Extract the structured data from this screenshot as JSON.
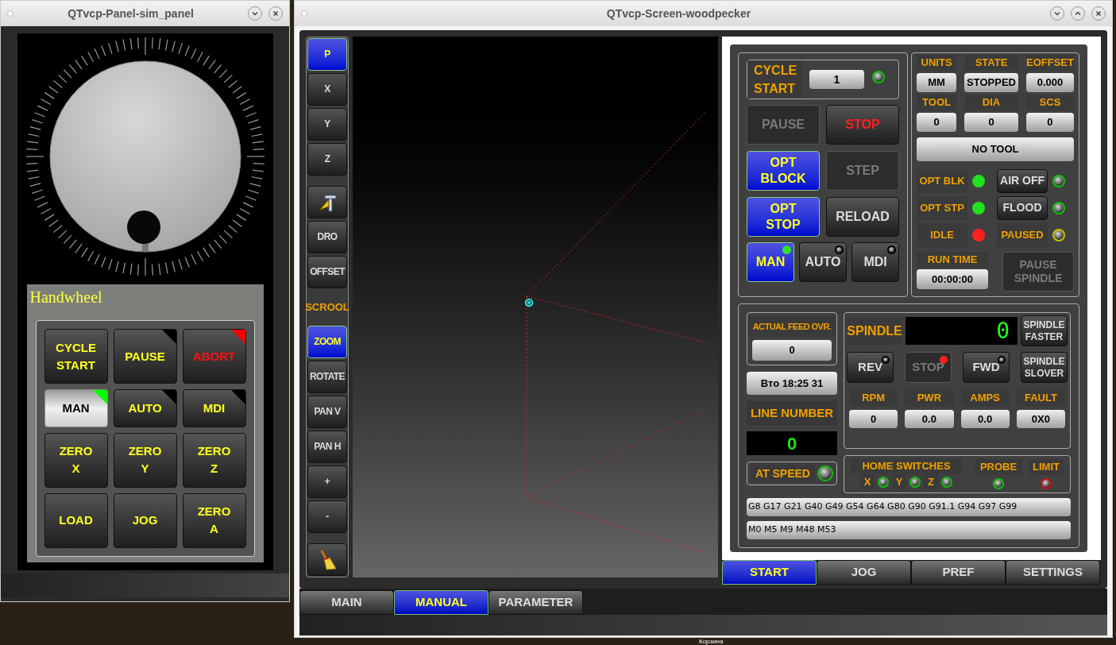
{
  "desktop": {
    "caption": "Корзина"
  },
  "panel_window": {
    "title": "QTvcp-Panel-sim_panel",
    "group_title": "Handwheel",
    "buttons": [
      {
        "label": "CYCLE\nSTART",
        "kind": "normal",
        "selected": false
      },
      {
        "label": "PAUSE",
        "kind": "normal",
        "selected": false,
        "color": "#000000"
      },
      {
        "label": "ABORT",
        "kind": "danger",
        "selected": false,
        "color": "#ff0000"
      },
      {
        "label": "MAN",
        "kind": "normal",
        "selected": true,
        "color": "#00ff00"
      },
      {
        "label": "AUTO",
        "kind": "normal",
        "selected": false,
        "color": "#000000"
      },
      {
        "label": "MDI",
        "kind": "normal",
        "selected": false,
        "color": "#000000"
      },
      {
        "label": "ZERO\nX",
        "kind": "normal",
        "selected": false
      },
      {
        "label": "ZERO\nY",
        "kind": "normal",
        "selected": false
      },
      {
        "label": "ZERO\nZ",
        "kind": "normal",
        "selected": false
      },
      {
        "label": "LOAD",
        "kind": "normal",
        "selected": false
      },
      {
        "label": "JOG",
        "kind": "normal",
        "selected": false
      },
      {
        "label": "ZERO\nA",
        "kind": "normal",
        "selected": false
      }
    ]
  },
  "screen_window": {
    "title": "QTvcp-Screen-woodpecker",
    "view_toolbar": [
      {
        "kind": "button",
        "label": "P",
        "selected": true
      },
      {
        "kind": "button",
        "label": "X",
        "selected": false
      },
      {
        "kind": "button",
        "label": "Y",
        "selected": false
      },
      {
        "kind": "button",
        "label": "Z",
        "selected": false
      },
      {
        "kind": "measure",
        "selected": false
      },
      {
        "kind": "button",
        "label": "DRO",
        "selected": false
      },
      {
        "kind": "button",
        "label": "OFFSET",
        "selected": false
      },
      {
        "kind": "label",
        "label": "SCROOL",
        "selected": false
      },
      {
        "kind": "button",
        "label": "ZOOM",
        "selected": true
      },
      {
        "kind": "button",
        "label": "ROTATE",
        "selected": false
      },
      {
        "kind": "button",
        "label": "PAN V",
        "selected": false
      },
      {
        "kind": "button",
        "label": "PAN H",
        "selected": false
      },
      {
        "kind": "button",
        "label": "+",
        "selected": false
      },
      {
        "kind": "button",
        "label": "-",
        "selected": false
      },
      {
        "kind": "clear",
        "selected": false
      }
    ],
    "cycle_start": {
      "label": "CYCLE\nSTART",
      "value": "1",
      "led": {
        "on": false,
        "color": "#10c010"
      }
    },
    "program_buttons": [
      {
        "label": "PAUSE",
        "kind": "normal",
        "selected": false,
        "disabled": true
      },
      {
        "label": "STOP",
        "kind": "danger",
        "selected": false,
        "disabled": false
      },
      {
        "label": "OPT\nBLOCK",
        "kind": "normal",
        "selected": true,
        "disabled": false
      },
      {
        "label": "STEP",
        "kind": "normal",
        "selected": false,
        "disabled": true
      },
      {
        "label": "OPT\nSTOP",
        "kind": "normal",
        "selected": true,
        "disabled": false
      },
      {
        "label": "RELOAD",
        "kind": "normal",
        "selected": false,
        "disabled": false
      }
    ],
    "modes": [
      {
        "label": "MAN",
        "selected": true,
        "led": {
          "on": true,
          "color": "#30e030"
        }
      },
      {
        "label": "AUTO",
        "selected": false,
        "led": {
          "on": false,
          "color": "#000000"
        }
      },
      {
        "label": "MDI",
        "selected": false,
        "led": {
          "on": false,
          "color": "#000000"
        }
      }
    ],
    "status_fields": [
      {
        "label": "UNITS",
        "value": "MM"
      },
      {
        "label": "STATE",
        "value": "STOPPED"
      },
      {
        "label": "EOFFSET",
        "value": "0.000"
      },
      {
        "label": "TOOL",
        "value": "0"
      },
      {
        "label": "DIA",
        "value": "0"
      },
      {
        "label": "SCS",
        "value": "0"
      }
    ],
    "tool_name": "NO TOOL",
    "indicators": [
      {
        "kind": "label",
        "label": "OPT BLK",
        "led": {
          "on": true,
          "color": "#20e020"
        }
      },
      {
        "kind": "button",
        "label": "AIR OFF",
        "led": {
          "on": false,
          "color": "#10c010"
        }
      },
      {
        "kind": "label",
        "label": "OPT STP",
        "led": {
          "on": true,
          "color": "#20e020"
        }
      },
      {
        "kind": "button",
        "label": "FLOOD",
        "led": {
          "on": false,
          "color": "#10c010"
        }
      },
      {
        "kind": "label",
        "label": "IDLE",
        "led": {
          "on": true,
          "color": "#ff2020"
        }
      },
      {
        "kind": "label",
        "label": "PAUSED",
        "led": {
          "on": false,
          "color": "#c8c000"
        }
      }
    ],
    "run_time": {
      "label": "RUN TIME",
      "value": "00:00:00"
    },
    "pause_spindle": {
      "label": "PAUSE\nSPINDLE",
      "disabled": true
    },
    "feed_override": {
      "label": "ACTUAL FEED OVR.",
      "value": "0"
    },
    "clock": "Вто 18:25 31",
    "line_number": {
      "label": "LINE NUMBER",
      "value": "0"
    },
    "at_speed": {
      "label": "AT SPEED",
      "led": {
        "on": false,
        "color": "#10c010"
      }
    },
    "spindle": {
      "label": "SPINDLE",
      "display": "0",
      "faster": "SPINDLE\nFASTER",
      "slower": "SPINDLE\nSLOVER",
      "direction_buttons": [
        {
          "label": "REV",
          "disabled": false,
          "led": {
            "on": false,
            "color": "#000000"
          }
        },
        {
          "label": "STOP",
          "disabled": true,
          "led": {
            "on": true,
            "color": "#ff2020"
          }
        },
        {
          "label": "FWD",
          "disabled": false,
          "led": {
            "on": false,
            "color": "#000000"
          }
        }
      ],
      "readings": [
        {
          "label": "RPM",
          "value": "0"
        },
        {
          "label": "PWR",
          "value": "0.0"
        },
        {
          "label": "AMPS",
          "value": "0.0"
        },
        {
          "label": "FAULT",
          "value": "0X0"
        }
      ]
    },
    "home_switches": {
      "label": "HOME SWITCHES",
      "axes": [
        {
          "label": "X",
          "led": {
            "on": false,
            "color": "#10c010"
          }
        },
        {
          "label": "Y",
          "led": {
            "on": false,
            "color": "#10c010"
          }
        },
        {
          "label": "Z",
          "led": {
            "on": false,
            "color": "#10c010"
          }
        }
      ]
    },
    "probe": {
      "label": "PROBE",
      "led": {
        "on": false,
        "color": "#10c010"
      }
    },
    "limit": {
      "label": "LIMIT",
      "led": {
        "on": false,
        "color": "#d01010"
      }
    },
    "gcodes": "G8 G17 G21 G40 G49 G54 G64 G80 G90 G91.1 G94 G97 G99",
    "mcodes": "M0 M5 M9 M48 M53",
    "panel_tabs": [
      {
        "label": "START",
        "selected": true
      },
      {
        "label": "JOG",
        "selected": false
      },
      {
        "label": "PREF",
        "selected": false
      },
      {
        "label": "SETTINGS",
        "selected": false
      }
    ],
    "main_tabs": [
      {
        "label": "MAIN",
        "selected": false
      },
      {
        "label": "MANUAL",
        "selected": true
      },
      {
        "label": "PARAMETER",
        "selected": false
      }
    ]
  }
}
